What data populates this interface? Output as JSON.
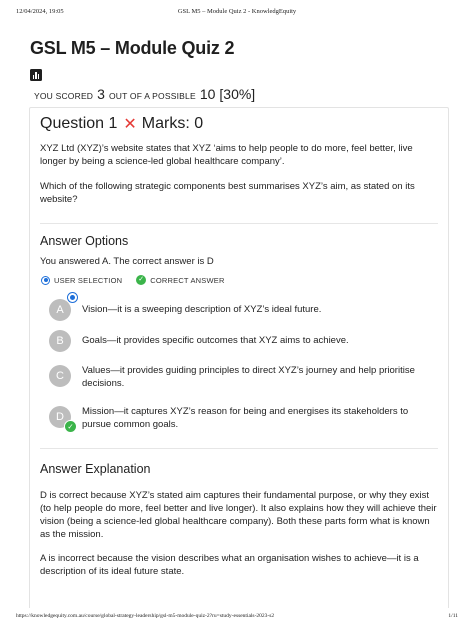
{
  "print_header": {
    "date": "12/04/2024, 19:05",
    "title": "GSL M5 – Module Quiz 2 - KnowledgEquity"
  },
  "page": {
    "title": "GSL M5 – Module Quiz 2",
    "icon": "bar-chart-icon"
  },
  "score": {
    "you_scored_label": "YOU SCORED",
    "score": "3",
    "out_of_label": "OUT OF A POSSIBLE",
    "possible": "10",
    "percent": "[30%]"
  },
  "question": {
    "title": "Question 1",
    "result_icon": "✕",
    "marks": "Marks: 0",
    "stem": "XYZ Ltd (XYZ)’s website states that XYZ ‘aims to help people to do more, feel better, live longer by being a science-led global healthcare company’.",
    "prompt": "Which of the following strategic components best summarises XYZ’s aim, as stated on its website?"
  },
  "answer_options": {
    "heading": "Answer Options",
    "answered_text": "You answered A. The correct answer is D",
    "legend_user": "USER SELECTION",
    "legend_correct": "CORRECT ANSWER",
    "check_glyph": "✓",
    "options": [
      {
        "letter": "A",
        "text": "Vision—it is a sweeping description of XYZ’s ideal future."
      },
      {
        "letter": "B",
        "text": "Goals—it provides specific outcomes that XYZ aims to achieve."
      },
      {
        "letter": "C",
        "text": "Values—it provides guiding principles to direct XYZ’s journey and help prioritise decisions."
      },
      {
        "letter": "D",
        "text": "Mission—it captures XYZ’s reason for being and energises its stakeholders to pursue common goals."
      }
    ]
  },
  "explanation": {
    "heading": "Answer Explanation",
    "paragraphs": [
      "D is correct because XYZ’s stated aim captures their fundamental purpose, or why they exist (to help people do more, feel better and live longer). It also explains how they will achieve their vision (being a science-led global healthcare company). Both these parts form what is known as the mission.",
      "A is incorrect because the vision describes what an organisation wishes to achieve—it is a description of its ideal future state."
    ]
  },
  "print_footer": {
    "url": "https://knowledgequity.com.au/course/global-strategy-leadership/gsl-m5-module-quiz-2?ru=study-essentials-2023-s2",
    "page": "1/11"
  },
  "colors": {
    "selection_blue": "#1e6fd9",
    "correct_green": "#3bb44a",
    "wrong_red": "#e53935",
    "option_grey": "#bdbdbd"
  }
}
